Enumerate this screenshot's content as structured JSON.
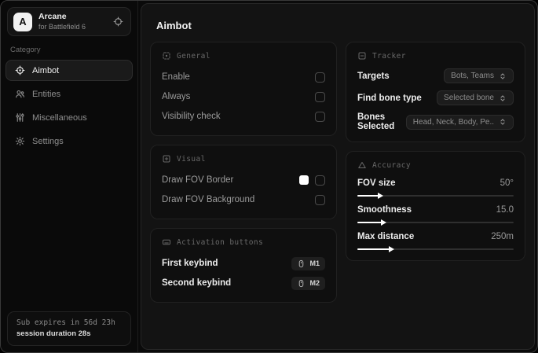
{
  "sidebar": {
    "brand": {
      "initial": "A",
      "name": "Arcane",
      "subtitle": "for Battlefield 6"
    },
    "category_label": "Category",
    "items": [
      {
        "label": "Aimbot"
      },
      {
        "label": "Entities"
      },
      {
        "label": "Miscellaneous"
      },
      {
        "label": "Settings"
      }
    ],
    "footer": {
      "line1": "Sub expires in 56d 23h",
      "line2": "session duration 28s"
    }
  },
  "main": {
    "title": "Aimbot",
    "general": {
      "title": "General",
      "rows": [
        {
          "label": "Enable"
        },
        {
          "label": "Always"
        },
        {
          "label": "Visibility check"
        }
      ]
    },
    "visual": {
      "title": "Visual",
      "rows": [
        {
          "label": "Draw FOV Border",
          "swatch": "#ffffff"
        },
        {
          "label": "Draw FOV Background"
        }
      ]
    },
    "activation": {
      "title": "Activation buttons",
      "rows": [
        {
          "label": "First keybind",
          "key": "M1"
        },
        {
          "label": "Second keybind",
          "key": "M2"
        }
      ]
    },
    "tracker": {
      "title": "Tracker",
      "rows": [
        {
          "label": "Targets",
          "value": "Bots, Teams"
        },
        {
          "label": "Find bone type",
          "value": "Selected bone"
        },
        {
          "label": "Bones Selected",
          "value": "Head, Neck, Body, Pe.."
        }
      ]
    },
    "accuracy": {
      "title": "Accuracy",
      "sliders": [
        {
          "label": "FOV size",
          "value": "50°",
          "percent": 14
        },
        {
          "label": "Smoothness",
          "value": "15.0",
          "percent": 16
        },
        {
          "label": "Max distance",
          "value": "250m",
          "percent": 21
        }
      ]
    }
  },
  "colors": {
    "accent_swatch": "#ffffff",
    "panel": "#131313",
    "card": "#0f0f0f"
  }
}
